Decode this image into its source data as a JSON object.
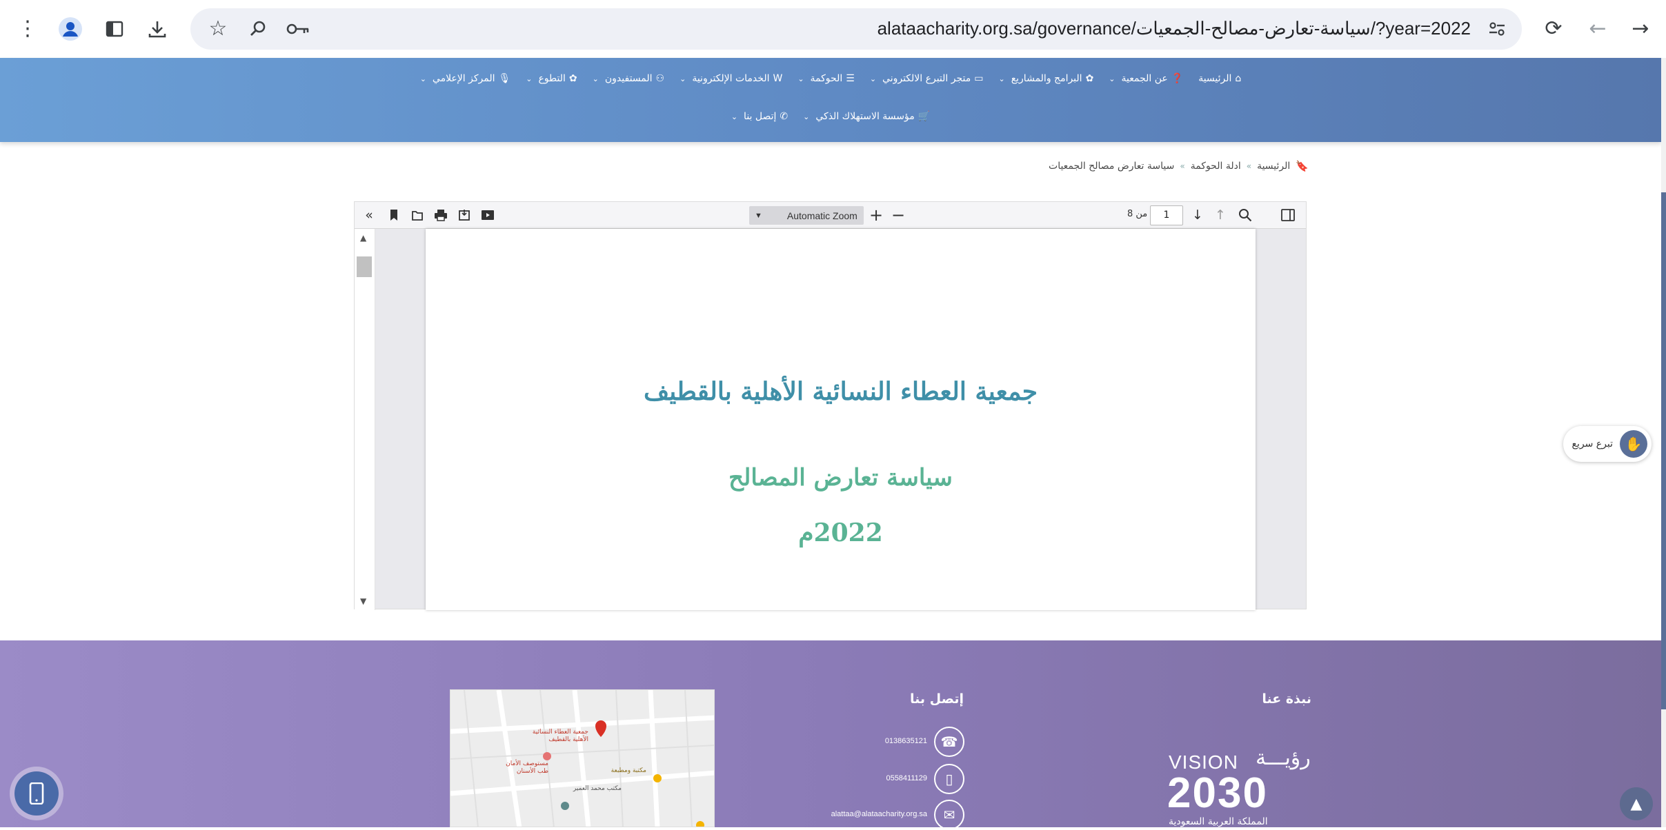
{
  "browser": {
    "url": "alataacharity.org.sa/governance/سياسة-تعارض-مصالح-الجمعيات/?year=2022",
    "icons": [
      "more-vert-icon",
      "profile-icon",
      "side-panel-icon",
      "download-icon",
      "star-icon",
      "zoom-icon",
      "password-key-icon",
      "site-settings-icon",
      "reload-icon",
      "back-icon",
      "forward-icon"
    ]
  },
  "nav": {
    "row1": [
      {
        "label": "الرئيسية",
        "icon": "home-icon",
        "glyph": "⌂",
        "caret": false
      },
      {
        "label": "عن الجمعية",
        "icon": "info-icon",
        "glyph": "❓",
        "caret": true
      },
      {
        "label": "البرامج والمشاريع",
        "icon": "programs-icon",
        "glyph": "✿",
        "caret": true
      },
      {
        "label": "متجر التبرع الالكتروني",
        "icon": "card-icon",
        "glyph": "▭",
        "caret": true
      },
      {
        "label": "الحوكمة",
        "icon": "list-icon",
        "glyph": "☰",
        "caret": true
      },
      {
        "label": "الخدمات الإلكترونية",
        "icon": "web-icon",
        "glyph": "W",
        "caret": true
      },
      {
        "label": "المستفيدون",
        "icon": "user-icon",
        "glyph": "⚇",
        "caret": true
      },
      {
        "label": "التطوع",
        "icon": "volunteer-icon",
        "glyph": "✿",
        "caret": true
      },
      {
        "label": "المركز الإعلامي",
        "icon": "mic-icon",
        "glyph": "🎙",
        "caret": true
      }
    ],
    "row2": [
      {
        "label": "مؤسسة الاستهلاك الذكي",
        "icon": "cart-icon",
        "glyph": "🛒",
        "caret": true
      },
      {
        "label": "إتصل بنا",
        "icon": "phone-icon",
        "glyph": "✆",
        "caret": true
      }
    ]
  },
  "breadcrumb": {
    "items": [
      "الرئيسية",
      "ادلة الحوكمة",
      "سياسة تعارض مصالح الجمعيات"
    ],
    "separator": "»"
  },
  "pdf_viewer": {
    "zoom": "Automatic Zoom",
    "page_number": "1",
    "page_of": "من 8",
    "page": {
      "org_name": "جمعية العطاء النسائية الأهلية بالقطيف",
      "doc_title": "سياسة تعارض المصالح",
      "year": "2022م"
    }
  },
  "quick_donate": {
    "label": "تبرع سريع"
  },
  "footer": {
    "about_title": "نبذة عنا",
    "contact_title": "إتصل بنا",
    "vision": {
      "arabic": "رؤيـــة",
      "latin": "VISION",
      "year": "2030",
      "caption": "المملكة العربية السعودية"
    },
    "contacts": [
      {
        "icon": "phone-icon",
        "glyph": "☎",
        "value": "0138635121"
      },
      {
        "icon": "mobile-icon",
        "glyph": "▯",
        "value": "0558411129"
      },
      {
        "icon": "mail-icon",
        "glyph": "✉",
        "value": "alattaa@alataacharity.org.sa"
      }
    ],
    "map_labels": [
      "جمعية العطاء النسائية",
      "الأهلية بالقطيف",
      "مستوصف الأمان",
      "طب الأسنان",
      "مكتبة ومطبعة",
      "مكتب محمد العمير"
    ]
  },
  "colors": {
    "nav_start": "#6b9fd6",
    "nav_end": "#5677ad",
    "org_name": "#3f8fa8",
    "doc_title": "#5ab394",
    "footer_start": "#9b8bc7",
    "footer_end": "#7b6d9e"
  }
}
